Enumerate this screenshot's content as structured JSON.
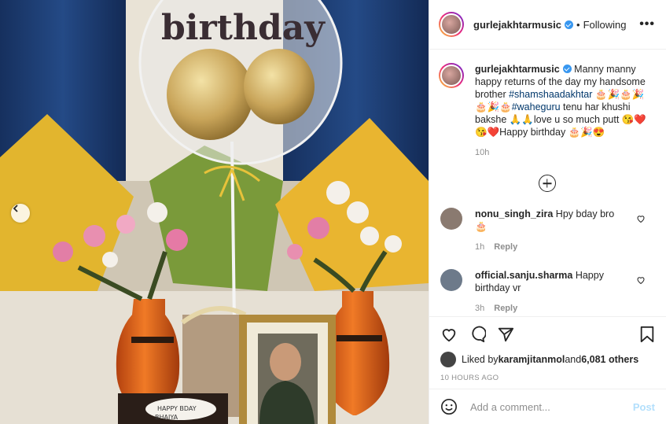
{
  "header": {
    "username": "gurlejakhtarmusic",
    "dot": "•",
    "follow_label": "Following",
    "more": "•••"
  },
  "caption": {
    "username": "gurlejakhtarmusic",
    "text_1": "Manny manny happy returns of the day my handsome brother ",
    "hashtag": "#shamshaadakhtar",
    "text_2": " 🎂🎉🎂🎉🎂🎉🎂",
    "mention": "#waheguru",
    "text_3": " tenu har khushi bakshe 🙏🙏love u so much putt 😘❤️😘❤️Happy birthday 🎂🎉😍",
    "time": "10h"
  },
  "comments": [
    {
      "username": "nonu_singh_zira",
      "text": " Hpy bday bro 🎂",
      "time": "1h",
      "reply": "Reply"
    },
    {
      "username": "official.sanju.sharma",
      "text": " Happy birthday vr",
      "time": "3h",
      "reply": "Reply"
    }
  ],
  "likes": {
    "prefix": "Liked by ",
    "user": "karamjitanmol",
    "middle": " and ",
    "count": "6,081 others"
  },
  "timestamp": "10 HOURS AGO",
  "add_comment": {
    "placeholder": "Add a comment...",
    "post_label": "Post"
  },
  "photo": {
    "balloon_text": "birthday",
    "cake_text_1": "HAPPY BDAY",
    "cake_text_2": "BHAIYA"
  },
  "colors": {
    "link": "#00376b",
    "verified": "#3897f0",
    "muted": "#8e8e8e",
    "post_disabled": "#b2dffc"
  }
}
